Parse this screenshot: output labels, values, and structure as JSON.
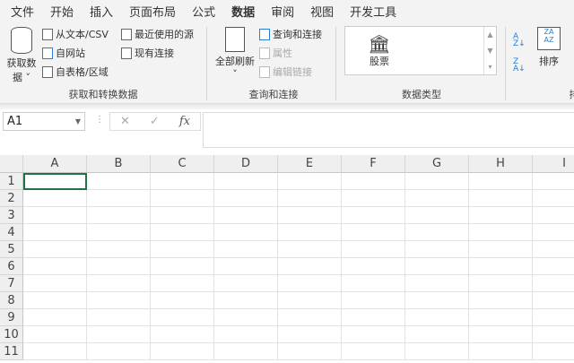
{
  "tabs": [
    "文件",
    "开始",
    "插入",
    "页面布局",
    "公式",
    "数据",
    "审阅",
    "视图",
    "开发工具"
  ],
  "active_tab": "数据",
  "ribbon": {
    "get_data": {
      "label1": "获取数",
      "label2": "据 ˅",
      "from_csv": "从文本/CSV",
      "from_web": "自网站",
      "from_table": "自表格/区域",
      "recent": "最近使用的源",
      "existing": "现有连接",
      "group": "获取和转换数据"
    },
    "queries": {
      "refresh1": "全部刷新",
      "refresh2": "˅",
      "queries_conn": "查询和连接",
      "properties": "属性",
      "edit_links": "编辑链接",
      "group": "查询和连接"
    },
    "data_types": {
      "stocks": "股票",
      "group": "数据类型"
    },
    "sort": {
      "sort": "排序",
      "group": "排"
    }
  },
  "formula_bar": {
    "name_box": "A1",
    "cancel": "✕",
    "enter": "✓",
    "fx": "fx",
    "value": ""
  },
  "columns": [
    "A",
    "B",
    "C",
    "D",
    "E",
    "F",
    "G",
    "H",
    "I"
  ],
  "rows": [
    "1",
    "2",
    "3",
    "4",
    "5",
    "6",
    "7",
    "8",
    "9",
    "10",
    "11"
  ]
}
